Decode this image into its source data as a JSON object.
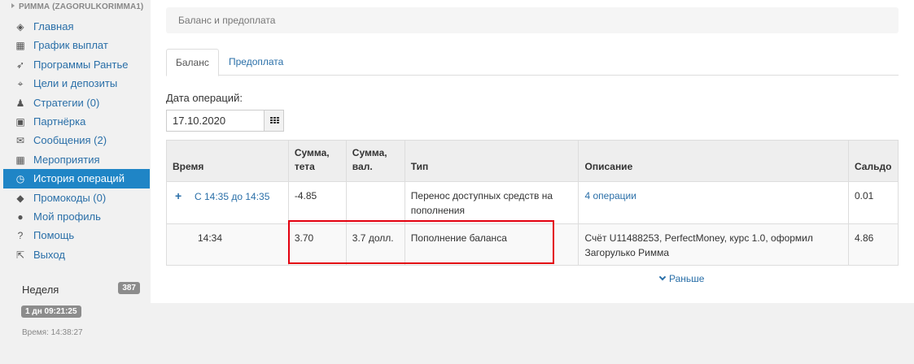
{
  "sidebar": {
    "user": "РИММА (ZAGORULKORIMMA1)",
    "items": [
      {
        "label": "Главная",
        "icon": "dashboard-icon",
        "glyph": "◈"
      },
      {
        "label": "График выплат",
        "icon": "calendar-icon",
        "glyph": "▦"
      },
      {
        "label": "Программы Рантье",
        "icon": "rocket-icon",
        "glyph": "➶"
      },
      {
        "label": "Цели и депозиты",
        "icon": "crosshairs-icon",
        "glyph": "⌖"
      },
      {
        "label": "Стратегии (0)",
        "icon": "chess-pawn-icon",
        "glyph": "♟"
      },
      {
        "label": "Партнёрка",
        "icon": "briefcase-icon",
        "glyph": "▣"
      },
      {
        "label": "Сообщения (2)",
        "icon": "envelope-icon",
        "glyph": "✉"
      },
      {
        "label": "Мероприятия",
        "icon": "calendar-icon",
        "glyph": "▦"
      },
      {
        "label": "История операций",
        "icon": "history-clock-icon",
        "glyph": "◷",
        "active": true
      },
      {
        "label": "Промокоды (0)",
        "icon": "tag-icon",
        "glyph": "◆"
      },
      {
        "label": "Мой профиль",
        "icon": "user-icon",
        "glyph": "●"
      },
      {
        "label": "Помощь",
        "icon": "question-circle-icon",
        "glyph": "?"
      },
      {
        "label": "Выход",
        "icon": "external-link-icon",
        "glyph": "⇱"
      }
    ],
    "week_label": "Неделя",
    "week_count": "387",
    "timer": "1 дн 09:21:25",
    "time_now": "Время: 14:38:27"
  },
  "breadcrumb": "Баланс и предоплата",
  "tabs": {
    "balance": "Баланс",
    "prepay": "Предоплата"
  },
  "date_filter": {
    "label": "Дата операций:",
    "value": "17.10.2020"
  },
  "table": {
    "headers": {
      "time": "Время",
      "sum_teta_1": "Сумма,",
      "sum_teta_2": "тета",
      "sum_val_1": "Сумма,",
      "sum_val_2": "вал.",
      "type": "Тип",
      "desc": "Описание",
      "balance": "Сальдо"
    },
    "rows": [
      {
        "time": "С 14:35 до 14:35",
        "teta": "-4.85",
        "val": "",
        "type": "Перенос доступных средств на пополнения",
        "desc": "4 операции",
        "balance": "0.01"
      },
      {
        "time": "14:34",
        "teta": "3.70",
        "val": "3.7 долл.",
        "type": "Пополнение баланса",
        "desc": "Счёт U11488253, PerfectMoney, курс 1.0, оформил Загорулько Римма",
        "balance": "4.86"
      }
    ]
  },
  "earlier": "Раньше",
  "colors": {
    "accent": "#1f85c6",
    "link": "#2a6fa8",
    "highlight": "#e3000f"
  }
}
